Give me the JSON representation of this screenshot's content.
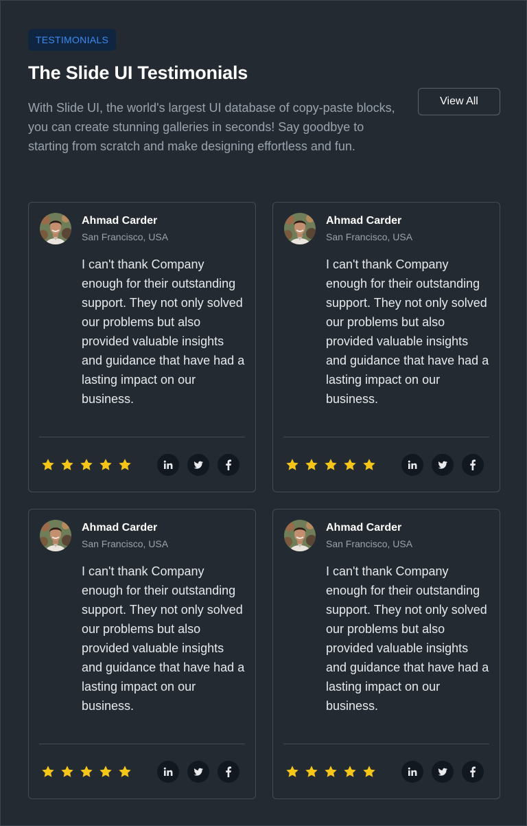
{
  "header": {
    "badge": "TESTIMONIALS",
    "title": "The Slide UI Testimonials",
    "description": "With Slide UI, the world's largest UI database of copy-paste blocks, you can create stunning galleries in seconds! Say goodbye to starting from scratch and make designing effortless and fun.",
    "view_all": "View All"
  },
  "colors": {
    "background": "#232a31",
    "accent": "#3d8bf2",
    "star": "#f5c518"
  },
  "testimonials": [
    {
      "name": "Ahmad Carder",
      "location": "San Francisco, USA",
      "quote": "I can't thank Company enough for their outstanding support. They not only solved our problems but also provided valuable insights and guidance that have had a lasting impact on our business.",
      "rating": 5,
      "socials": [
        "linkedin-icon",
        "twitter-icon",
        "facebook-icon"
      ]
    },
    {
      "name": "Ahmad Carder",
      "location": "San Francisco, USA",
      "quote": "I can't thank Company enough for their outstanding support. They not only solved our problems but also provided valuable insights and guidance that have had a lasting impact on our business.",
      "rating": 5,
      "socials": [
        "linkedin-icon",
        "twitter-icon",
        "facebook-icon"
      ]
    },
    {
      "name": "Ahmad Carder",
      "location": "San Francisco, USA",
      "quote": "I can't thank Company enough for their outstanding support. They not only solved our problems but also provided valuable insights and guidance that have had a lasting impact on our business.",
      "rating": 5,
      "socials": [
        "linkedin-icon",
        "twitter-icon",
        "facebook-icon"
      ]
    },
    {
      "name": "Ahmad Carder",
      "location": "San Francisco, USA",
      "quote": "I can't thank Company enough for their outstanding support. They not only solved our problems but also provided valuable insights and guidance that have had a lasting impact on our business.",
      "rating": 5,
      "socials": [
        "linkedin-icon",
        "twitter-icon",
        "facebook-icon"
      ]
    }
  ]
}
